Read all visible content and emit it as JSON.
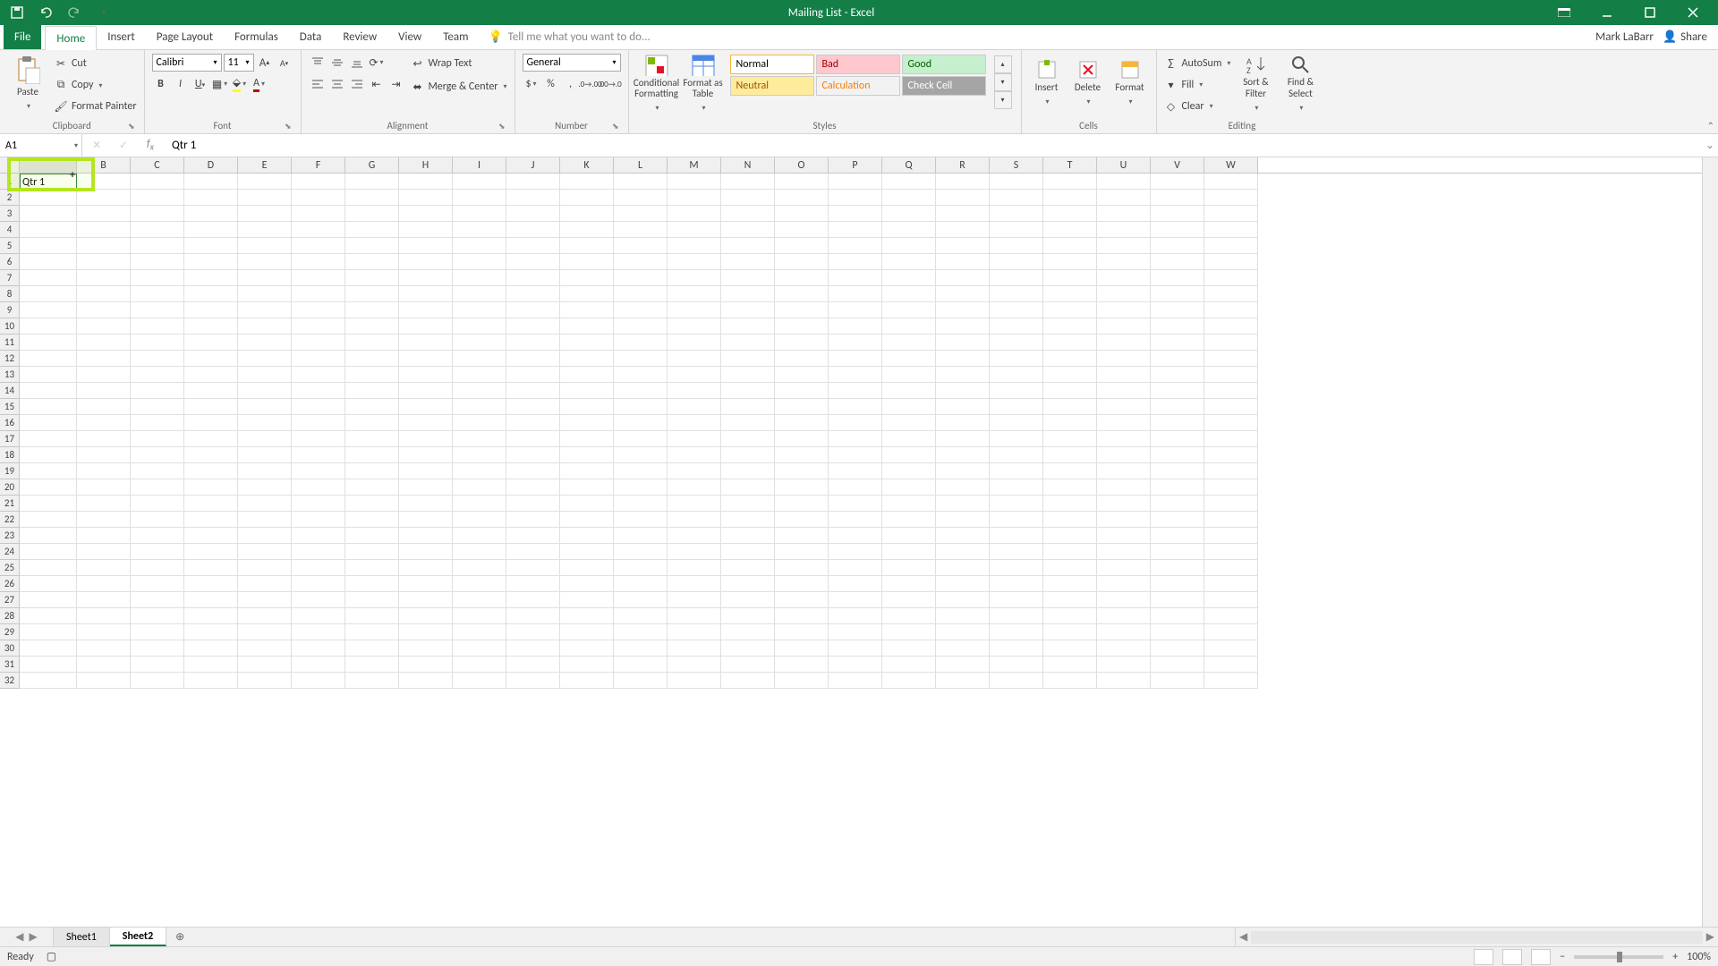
{
  "titlebar": {
    "title": "Mailing List - Excel"
  },
  "tabs": {
    "file": "File",
    "items": [
      "Home",
      "Insert",
      "Page Layout",
      "Formulas",
      "Data",
      "Review",
      "View",
      "Team"
    ],
    "active": "Home",
    "tellme": "Tell me what you want to do...",
    "user": "Mark LaBarr",
    "share": "Share"
  },
  "ribbon": {
    "clipboard": {
      "paste": "Paste",
      "cut": "Cut",
      "copy": "Copy",
      "painter": "Format Painter",
      "label": "Clipboard"
    },
    "font": {
      "name": "Calibri",
      "size": "11",
      "label": "Font"
    },
    "alignment": {
      "wrap": "Wrap Text",
      "merge": "Merge & Center",
      "label": "Alignment"
    },
    "number": {
      "format": "General",
      "label": "Number"
    },
    "styles": {
      "cond": "Conditional Formatting",
      "fat": "Format as Table",
      "items": [
        "Normal",
        "Bad",
        "Good",
        "Neutral",
        "Calculation",
        "Check Cell"
      ],
      "label": "Styles"
    },
    "cells": {
      "insert": "Insert",
      "delete": "Delete",
      "format": "Format",
      "label": "Cells"
    },
    "editing": {
      "autosum": "AutoSum",
      "fill": "Fill",
      "clear": "Clear",
      "sort": "Sort & Filter",
      "find": "Find & Select",
      "label": "Editing"
    }
  },
  "namebox": "A1",
  "formula": "Qtr 1",
  "columns": [
    "B",
    "C",
    "D",
    "E",
    "F",
    "G",
    "H",
    "I",
    "J",
    "K",
    "L",
    "M",
    "N",
    "O",
    "P",
    "Q",
    "R",
    "S",
    "T",
    "U",
    "V",
    "W"
  ],
  "cellA1": "Qtr 1",
  "rows": [
    "1",
    "2",
    "3",
    "4",
    "5",
    "6",
    "7",
    "8",
    "9",
    "10",
    "11",
    "12",
    "13",
    "14",
    "15",
    "16",
    "17",
    "18",
    "19",
    "20",
    "21",
    "22",
    "23",
    "24",
    "25",
    "26",
    "27",
    "28",
    "29",
    "30",
    "31",
    "32"
  ],
  "sheets": {
    "items": [
      "Sheet1",
      "Sheet2"
    ],
    "active": "Sheet2"
  },
  "status": {
    "ready": "Ready",
    "zoom": "100%"
  }
}
